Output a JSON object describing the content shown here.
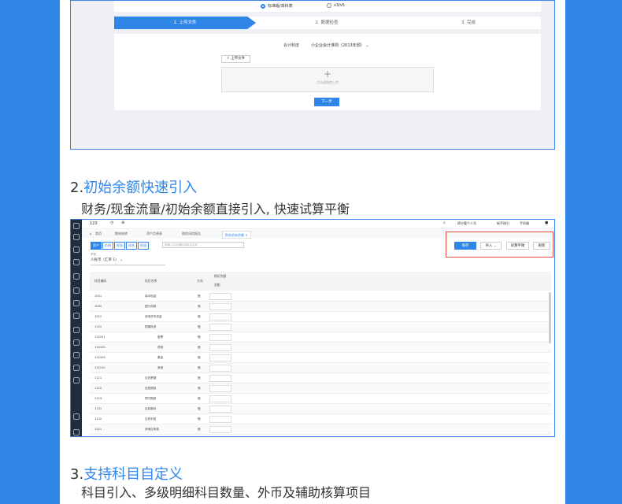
{
  "colors": {
    "brand": "#2f86e8",
    "highlight": "#e74c3c",
    "sidebar": "#1f2d3d"
  },
  "wizard": {
    "radio_options": [
      "标准版/单科表",
      "v3/v5"
    ],
    "steps": [
      "1. 上传文件",
      "2. 数据检查",
      "3. 完成"
    ],
    "accounting_label": "会计制度",
    "accounting_value": "小企业会计准则（2013年颁）",
    "upload_button": "上传文件",
    "drop_hint": "点击或拖拽上传",
    "next_button": "下一步"
  },
  "section2": {
    "number": "2.",
    "title": "初始余额快速引入",
    "subtitle": "财务/现金流量/初始余额直接引入, 快速试算平衡"
  },
  "section3": {
    "number": "3.",
    "title": "支持科目自定义",
    "subtitle": "科目引入、多级明细科目数量、外币及辅助核算项目"
  },
  "app": {
    "company": "123",
    "top_right": [
      "缔分看个人号",
      "新手指引",
      "手机端"
    ],
    "tabs": [
      "首页",
      "期末结转",
      "资产负债表",
      "税务风险报告",
      "财务初始余额"
    ],
    "filter_tabs": [
      "资产",
      "负债",
      "权益",
      "成本",
      "损益"
    ],
    "search_placeholder": "请输入科目编码或科目名称",
    "buttons": {
      "save": "保存",
      "import": "导入",
      "trial": "试算平衡",
      "refresh": "刷新"
    },
    "currency_label": "币别",
    "currency_value": "人民币（汇率 1）",
    "columns": [
      "科目编码",
      "科目名称",
      "方向",
      "期初余额",
      "金额"
    ],
    "rows": [
      {
        "code": "1001",
        "name": "库存现金",
        "dir": "借"
      },
      {
        "code": "1002",
        "name": "银行存款",
        "dir": "借"
      },
      {
        "code": "1012",
        "name": "其他货币资金",
        "dir": "借"
      },
      {
        "code": "1101",
        "name": "短期投资",
        "dir": "借"
      },
      {
        "code": "110101",
        "name": "股票",
        "dir": "借"
      },
      {
        "code": "110102",
        "name": "债券",
        "dir": "借"
      },
      {
        "code": "110103",
        "name": "基金",
        "dir": "借"
      },
      {
        "code": "110110",
        "name": "其他",
        "dir": "借"
      },
      {
        "code": "1121",
        "name": "应收票据",
        "dir": "借"
      },
      {
        "code": "1122",
        "name": "应收账款",
        "dir": "借"
      },
      {
        "code": "1123",
        "name": "预付账款",
        "dir": "借"
      },
      {
        "code": "1131",
        "name": "应收股利",
        "dir": "借"
      },
      {
        "code": "1132",
        "name": "应收利息",
        "dir": "借"
      },
      {
        "code": "1221",
        "name": "其他应收款",
        "dir": "借"
      }
    ]
  }
}
